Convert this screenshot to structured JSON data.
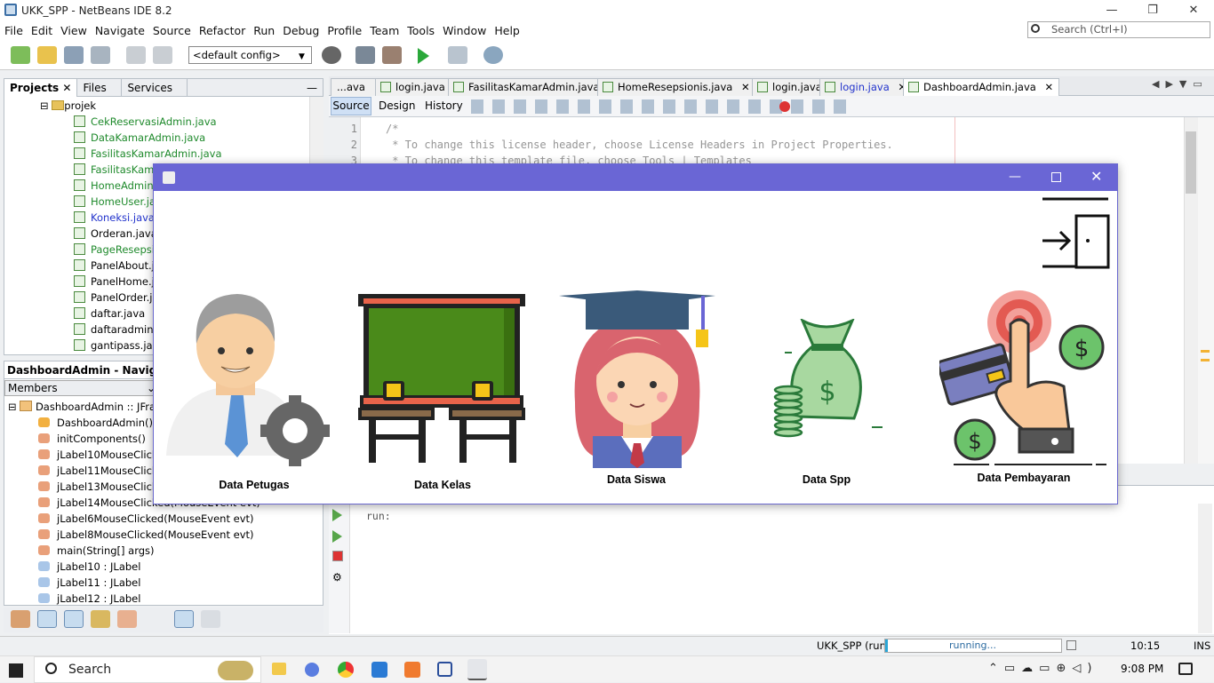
{
  "window": {
    "title": "UKK_SPP - NetBeans IDE 8.2"
  },
  "menu": [
    "File",
    "Edit",
    "View",
    "Navigate",
    "Source",
    "Refactor",
    "Run",
    "Debug",
    "Profile",
    "Team",
    "Tools",
    "Window",
    "Help"
  ],
  "search": {
    "placeholder": "Search (Ctrl+I)"
  },
  "toolbar": {
    "config": "<default config>"
  },
  "projects": {
    "tabs": [
      "Projects",
      "Files",
      "Services"
    ],
    "root": "projek",
    "files": [
      {
        "name": "CekReservasiAdmin.java",
        "c": "green"
      },
      {
        "name": "DataKamarAdmin.java",
        "c": "green"
      },
      {
        "name": "FasilitasKamarAdmin.java",
        "c": "green"
      },
      {
        "name": "FasilitasKamar",
        "c": "green"
      },
      {
        "name": "HomeAdmin.ja",
        "c": "green"
      },
      {
        "name": "HomeUser.jav",
        "c": "green"
      },
      {
        "name": "Koneksi.java",
        "c": "blue"
      },
      {
        "name": "Orderan.java",
        "c": ""
      },
      {
        "name": "PageResepsio",
        "c": "green"
      },
      {
        "name": "PanelAbout.ja",
        "c": ""
      },
      {
        "name": "PanelHome.jav",
        "c": ""
      },
      {
        "name": "PanelOrder.ja",
        "c": ""
      },
      {
        "name": "daftar.java",
        "c": ""
      },
      {
        "name": "daftaradmin.ja",
        "c": ""
      },
      {
        "name": "gantipass.java",
        "c": ""
      }
    ]
  },
  "navigator": {
    "title": "DashboardAdmin - Navigator",
    "filter": "Members",
    "root": "DashboardAdmin :: JFram",
    "members": [
      "DashboardAdmin()",
      "initComponents()",
      "jLabel10MouseClicked(",
      "jLabel11MouseClicked(",
      "jLabel13MouseClicked(",
      "jLabel14MouseClicked(MouseEvent evt)",
      "jLabel6MouseClicked(MouseEvent evt)",
      "jLabel8MouseClicked(MouseEvent evt)",
      "main(String[] args)",
      "jLabel10 : JLabel",
      "jLabel11 : JLabel",
      "jLabel12 : JLabel"
    ]
  },
  "editor": {
    "tabs": [
      "...ava",
      "login.java",
      "FasilitasKamarAdmin.java",
      "HomeResepsionis.java",
      "login.java",
      "login.java",
      "DashboardAdmin.java"
    ],
    "modes": [
      "Source",
      "Design",
      "History"
    ],
    "lines": [
      "1",
      "2",
      "3"
    ],
    "code": [
      "/*",
      " * To change this license header, choose License Headers in Project Properties.",
      " * To change this template file, choose Tools | Templates"
    ]
  },
  "output": {
    "text": "run:"
  },
  "status": {
    "project": "UKK_SPP (run)",
    "progress": "running...",
    "time": "10:15",
    "mode": "INS"
  },
  "taskbar": {
    "search": "Search",
    "clock": "9:08 PM"
  },
  "dialog": {
    "items": [
      "Data Petugas",
      "Data Kelas",
      "Data Siswa",
      "Data Spp",
      "Data Pembayaran"
    ]
  },
  "colors": {
    "dialog_title": "#6a66d5",
    "green_file": "#1f8a2c",
    "blue_file": "#2233cc"
  }
}
